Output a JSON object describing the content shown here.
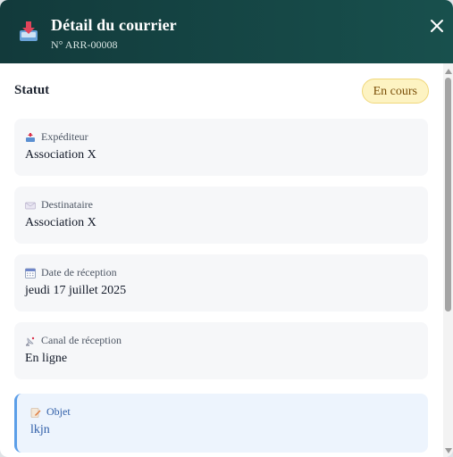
{
  "header": {
    "title": "Détail du courrier",
    "reference": "N° ARR-00008",
    "icon": "inbox-tray-icon",
    "close_icon": "close-icon",
    "colors": {
      "start": "#123a3b",
      "end": "#18504d"
    }
  },
  "status": {
    "label": "Statut",
    "badge": "En cours",
    "badge_color": "#fdf3c2"
  },
  "fields": [
    {
      "icon": "outbox-tray-icon",
      "label": "Expéditeur",
      "value": "Association X"
    },
    {
      "icon": "envelope-icon",
      "label": "Destinataire",
      "value": "Association X"
    },
    {
      "icon": "calendar-icon",
      "label": "Date de réception",
      "value": "jeudi 17 juillet 2025"
    },
    {
      "icon": "satellite-antenna-icon",
      "label": "Canal de réception",
      "value": "En ligne"
    },
    {
      "icon": "memo-pencil-icon",
      "label": "Objet",
      "value": "lkjn"
    }
  ]
}
